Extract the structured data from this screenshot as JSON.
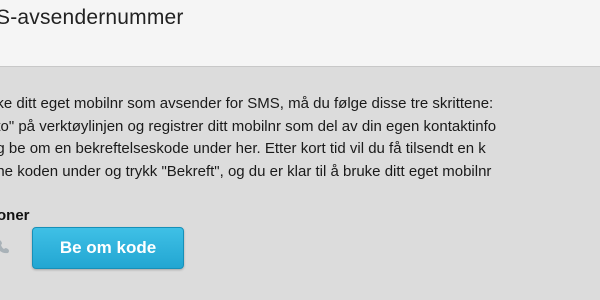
{
  "header": {
    "title": "S-avsendernummer"
  },
  "instructions": {
    "lines": [
      "uke ditt eget mobilnr som avsender for SMS, må du følge disse tre skrittene:",
      "nto\" på verktøylinjen og registrer ditt mobilnr som del av din egen kontaktinfo",
      "og be om en bekreftelseskode under her. Etter kort tid vil du få tilsendt en k",
      "nne koden under og trykk \"Bekreft\", og du er klar til å bruke ditt eget mobilnr"
    ]
  },
  "phone": {
    "label": "foner",
    "icon": "phone-icon",
    "request_button_label": "Be om kode"
  },
  "colors": {
    "header_bg": "#f5f5f5",
    "body_bg": "#dcdcdc",
    "button_bg": "#2aaed9",
    "button_text": "#ffffff"
  }
}
